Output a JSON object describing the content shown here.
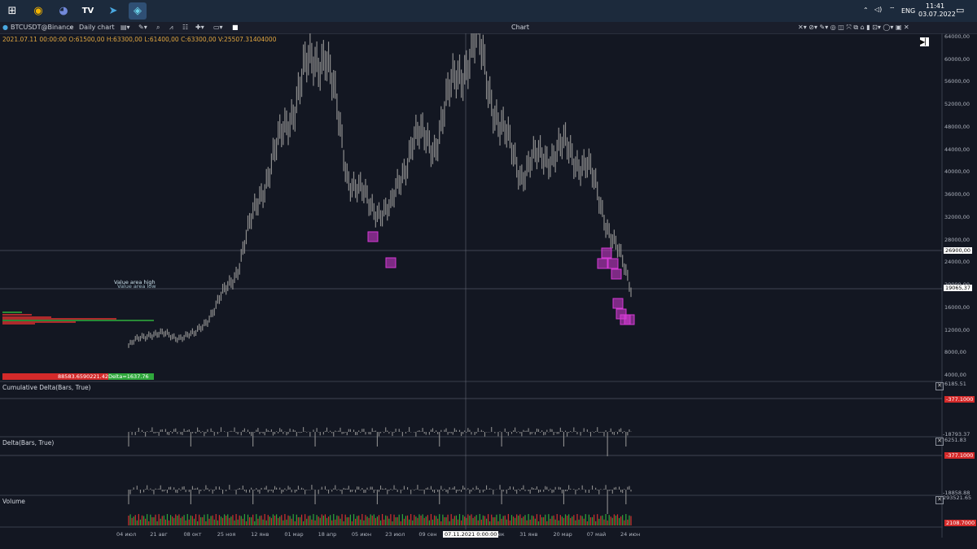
{
  "taskbar": {
    "apps": [
      {
        "name": "start",
        "icon": "windows-icon",
        "glyph": "⊞"
      },
      {
        "name": "chrome",
        "icon": "chrome-icon",
        "glyph": "◉"
      },
      {
        "name": "discord",
        "icon": "discord-icon",
        "glyph": "◕"
      },
      {
        "name": "tradingview",
        "icon": "tradingview-icon",
        "glyph": "TV"
      },
      {
        "name": "telegram",
        "icon": "telegram-icon",
        "glyph": "➤"
      },
      {
        "name": "trading-terminal",
        "icon": "terminal-icon",
        "glyph": "◈"
      }
    ],
    "lang": "ENG",
    "time": "11:41",
    "date": "03.07.2022"
  },
  "chart_window": {
    "symbol": "BTCUSDT@Binance",
    "timeframe": "Daily chart",
    "title": "Chart",
    "ohlc": "2021.07.11 00:00:00 O:61500,00 H:63300,00 L:61400,00 C:63300,00 V:25507.31404000"
  },
  "chart_data": [
    {
      "type": "candlestick",
      "title": "BTCUSDT@Binance",
      "price_axis": [
        "64000,00",
        "60000,00",
        "56000,00",
        "52000,00",
        "48000,00",
        "44000,00",
        "40000,00",
        "36000,00",
        "32000,00",
        "28000,00",
        "24000,00",
        "20000,00",
        "16000,00",
        "12000,00",
        "8000,00",
        "4000,00"
      ],
      "ylim": [
        4000,
        64000
      ],
      "current_price_label": "26900,00",
      "cursor_price_label": "19065,37",
      "x_ticks": [
        "04 июл",
        "21 авг",
        "08 окт",
        "25 ноя",
        "12 янв",
        "01 мар",
        "18 апр",
        "05 июн",
        "23 июл",
        "09 сен",
        "27 окт",
        "15 дек",
        "31 янв",
        "20 мар",
        "07 май",
        "24 июн"
      ],
      "cursor_time_label": "07.11.2021 0:00:00",
      "series": [
        {
          "x": [
            "2020-07",
            "2020-08",
            "2020-09",
            "2020-10",
            "2020-11",
            "2020-12",
            "2021-01",
            "2021-02",
            "2021-03",
            "2021-04",
            "2021-05",
            "2021-06",
            "2021-07",
            "2021-08",
            "2021-09",
            "2021-10",
            "2021-11",
            "2021-12",
            "2022-01",
            "2022-02",
            "2022-03",
            "2022-04",
            "2022-05",
            "2022-06"
          ],
          "values": [
            9200,
            11500,
            10800,
            11000,
            16000,
            23000,
            36000,
            46000,
            57000,
            62000,
            40000,
            34000,
            33000,
            46000,
            45000,
            57000,
            63000,
            48000,
            40000,
            43000,
            44000,
            41000,
            30000,
            19500
          ]
        }
      ],
      "volume_profile": {
        "label": "Value area high",
        "label2": "Value area low",
        "totals_left": "88583.6590221.42",
        "delta": "Delta=1637.76"
      },
      "markers": "magenta square markers at pullback / capitulation zones"
    },
    {
      "type": "bar",
      "title": "Cumulative Delta(Bars, True)",
      "scale_top": "6185.51",
      "scale_bottom": "-18793.37",
      "last_value": "-377.1000"
    },
    {
      "type": "bar",
      "title": "Delta(Bars, True)",
      "scale_top": "6251.83",
      "scale_bottom": "-18858.88",
      "last_value": "-377.1000"
    },
    {
      "type": "bar",
      "title": "Volume",
      "scale_top": "293521.65",
      "last_value": "2108.7000"
    }
  ],
  "colors": {
    "background": "#131722",
    "candle": "#8e8e8e",
    "marker": "#d63ad6",
    "up": "#2fa83c",
    "down": "#d43030",
    "price_tag": "#d42a2a"
  }
}
